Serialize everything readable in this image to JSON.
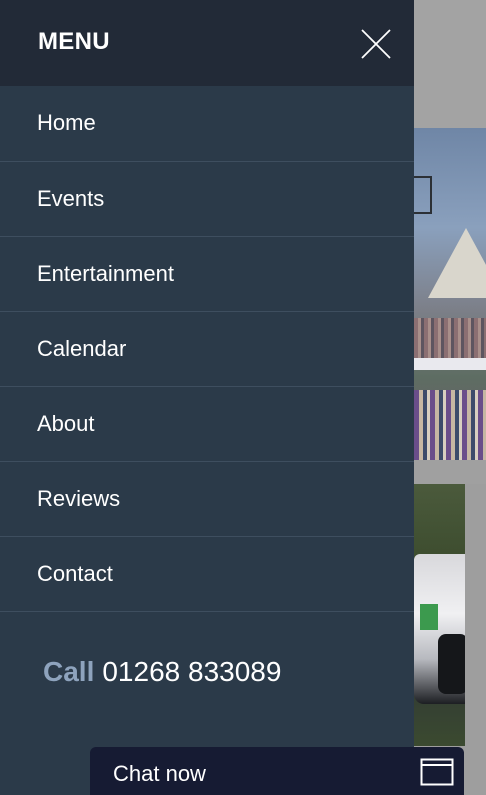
{
  "menu": {
    "title": "MENU",
    "close_icon": "close-icon",
    "items": [
      {
        "label": "Home"
      },
      {
        "label": "Events"
      },
      {
        "label": "Entertainment"
      },
      {
        "label": "Calendar"
      },
      {
        "label": "About"
      },
      {
        "label": "Reviews"
      },
      {
        "label": "Contact"
      }
    ],
    "call": {
      "label": "Call",
      "phone": "01268 833089"
    }
  },
  "chat": {
    "label": "Chat now",
    "icon": "chat-window-icon"
  },
  "colors": {
    "menu_background": "#2b3a49",
    "menu_header_background": "#222a37",
    "call_label": "#8ea3bd",
    "chat_background": "#161b33"
  }
}
